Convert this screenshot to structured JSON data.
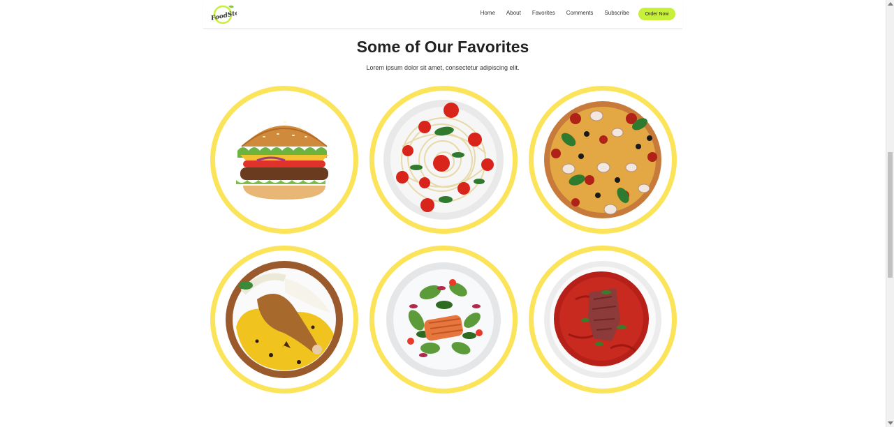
{
  "brand": {
    "logo_text": "FoodSto",
    "accent": "#c6f03a",
    "ring_color": "#fbe45a"
  },
  "nav": {
    "items": [
      {
        "label": "Home"
      },
      {
        "label": "About"
      },
      {
        "label": "Favorites"
      },
      {
        "label": "Comments"
      },
      {
        "label": "Subscribe"
      }
    ],
    "cta": "Order Now"
  },
  "section": {
    "title": "Some of Our Favorites",
    "subtitle": "Lorem ipsum dolor sit amet, consectetur adipiscing elit."
  },
  "dishes": [
    {
      "icon": "burger-image"
    },
    {
      "icon": "spaghetti-image"
    },
    {
      "icon": "pizza-image"
    },
    {
      "icon": "biryani-image"
    },
    {
      "icon": "salmon-salad-image"
    },
    {
      "icon": "borscht-soup-image"
    }
  ]
}
